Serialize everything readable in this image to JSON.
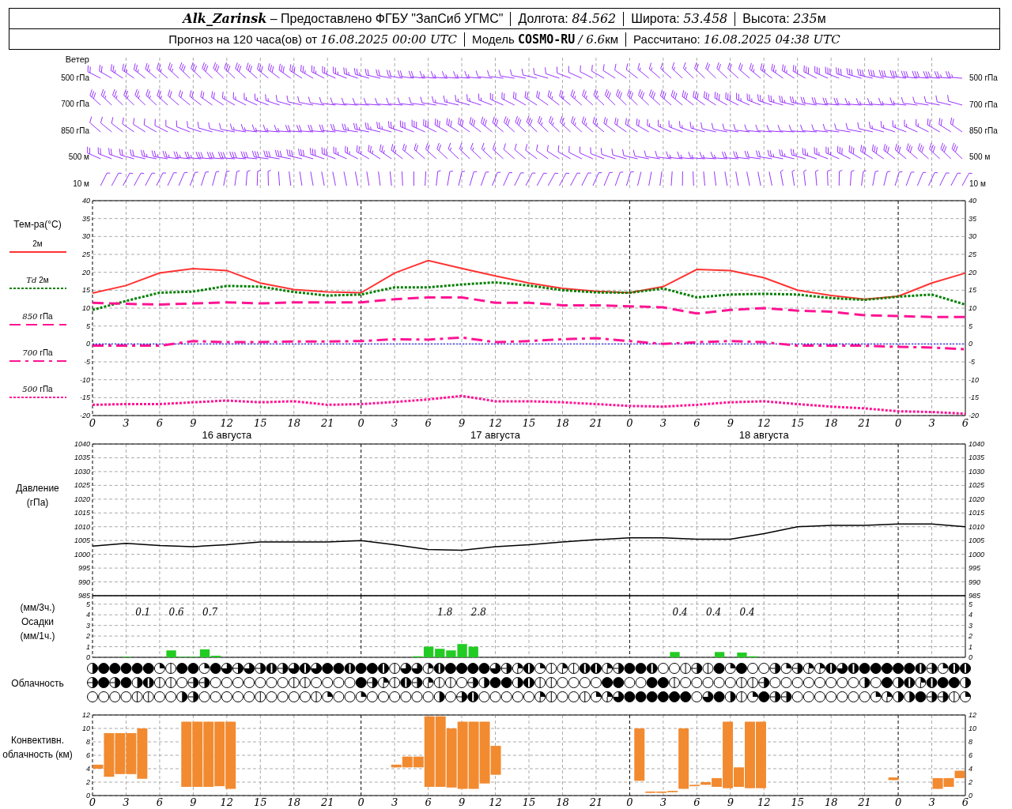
{
  "header": {
    "line1": [
      {
        "station": "Alk_Zarinsk",
        "label": "– Предоставлено ФГБУ \"ЗапСиб УГМС\""
      },
      {
        "label": "Долгота:",
        "value": "84.562"
      },
      {
        "label": "Широта:",
        "value": "53.458"
      },
      {
        "label": "Высота:",
        "value": "235",
        "unit": "м"
      }
    ],
    "line2": [
      {
        "label": "Прогноз на 120 часа(ов) от",
        "value": "16.08.2025 00:00 UTC"
      },
      {
        "label": "Модель",
        "model": "COSMO-RU",
        "value": "/ 6.6",
        "unit": "км"
      },
      {
        "label": "Рассчитано:",
        "value": "16.08.2025 04:38 UTC"
      }
    ]
  },
  "wind": {
    "title": "Ветер",
    "levels_left": [
      "500 гПа",
      "700 гПа",
      "850 гПа",
      "500 м",
      "10 м"
    ],
    "levels_right": [
      "500 гПа",
      "700 гПа",
      "850 гПа",
      "500 м",
      "10 м"
    ]
  },
  "temperature": {
    "dates": [
      "16 августа",
      "17 августа",
      "18 августа"
    ],
    "right_ticks": [
      "40",
      "35",
      "30",
      "25",
      "20",
      "15",
      "10",
      "5",
      "0",
      "-5",
      "-10",
      "-15",
      "-20"
    ],
    "chart_data": {
      "type": "line",
      "ylabel": "Тем-ра(°C)",
      "grid": true,
      "categories": [
        "0",
        "3",
        "6",
        "9",
        "12",
        "15",
        "18",
        "21",
        "0",
        "3",
        "6",
        "9",
        "12",
        "15",
        "18",
        "21",
        "0",
        "3",
        "6",
        "9",
        "12",
        "15",
        "18",
        "21",
        "0",
        "3",
        "6"
      ],
      "ylim": [
        -20,
        40
      ],
      "yticks": [
        -20,
        -15,
        -10,
        -5,
        0,
        5,
        10,
        15,
        20,
        25,
        30,
        35,
        40
      ],
      "series": [
        {
          "name": "2м",
          "color": "#ff3333",
          "line_style": "solid",
          "values": [
            14.2,
            16.3,
            19.8,
            21,
            20.5,
            17,
            15.2,
            14.5,
            14.3,
            19.8,
            23.3,
            21.1,
            19,
            17,
            15.5,
            14.7,
            14.3,
            16,
            20.8,
            20.5,
            18.5,
            15,
            13.5,
            12.5,
            13.3,
            17,
            19.8
          ]
        },
        {
          "name": "*Td* 2м",
          "color": "#008000",
          "line_style": "dotted",
          "values": [
            9.5,
            12,
            14.3,
            14.6,
            16.2,
            16,
            14.5,
            13.5,
            13.8,
            15.8,
            15.8,
            16.6,
            17.2,
            16.3,
            15,
            14.4,
            14.3,
            15.5,
            13,
            13.8,
            14,
            13.8,
            12.8,
            12.3,
            13.2,
            13.8,
            11
          ]
        },
        {
          "name": "*850* гПа",
          "color": "#ff1493",
          "line_style": "dashed",
          "values": [
            11.5,
            11.2,
            11,
            11.3,
            11.6,
            11.3,
            11.6,
            11.6,
            11.6,
            12.5,
            13,
            13,
            11.5,
            11.5,
            10.8,
            10.8,
            10.5,
            10.2,
            8.5,
            9.5,
            10,
            9.3,
            9,
            8,
            7.8,
            7.5,
            7.5
          ]
        },
        {
          "name": "*700* гПа",
          "color": "#ff1493",
          "line_style": "dashdot",
          "values": [
            -0.5,
            -0.5,
            -0.5,
            0.8,
            0.5,
            0.5,
            0.7,
            0.7,
            0.8,
            1.3,
            1.2,
            1.8,
            0.5,
            0.8,
            1.3,
            1.6,
            0.8,
            0,
            0.5,
            0.8,
            0.5,
            -0.5,
            -0.5,
            -0.5,
            -0.8,
            -1,
            -1.5
          ]
        },
        {
          "name": "*500* гПа",
          "color": "#ff1493",
          "line_style": "dotted",
          "values": [
            -17,
            -16.8,
            -16.8,
            -16.3,
            -15.8,
            -16.3,
            -16,
            -17,
            -16.8,
            -16.2,
            -15.5,
            -14.5,
            -16,
            -16,
            -16.3,
            -16.8,
            -17.3,
            -17.5,
            -17,
            -16.3,
            -16,
            -16.8,
            -17.5,
            -18,
            -18.8,
            -19,
            -19.5
          ]
        }
      ],
      "ref_lines": [
        {
          "axis": "y",
          "value": 0,
          "color": "#0000ff"
        }
      ]
    }
  },
  "pressure": {
    "right_ticks": [
      "1040",
      "1035",
      "1030",
      "1025",
      "1020",
      "1015",
      "1010",
      "1005",
      "1000",
      "995",
      "990",
      "985"
    ],
    "chart_data": {
      "type": "line",
      "ylabel": "Давление (гПа)",
      "grid": true,
      "ylim": [
        985,
        1040
      ],
      "yticks": [
        985,
        990,
        995,
        1000,
        1005,
        1010,
        1015,
        1020,
        1025,
        1030,
        1035,
        1040
      ],
      "series": [
        {
          "color": "#000000",
          "values": [
            1003,
            1004,
            1003.2,
            1002.8,
            1003.5,
            1004.5,
            1004.5,
            1004.5,
            1005,
            1003.5,
            1001.8,
            1001.5,
            1002.8,
            1003.5,
            1004.5,
            1005.3,
            1006,
            1006,
            1005.5,
            1005.5,
            1007.5,
            1010,
            1010.5,
            1010.5,
            1011,
            1011,
            1010
          ]
        }
      ]
    }
  },
  "precipitation": {
    "labels": [
      "(мм/3ч.)",
      "Осадки",
      "(мм/1ч.)"
    ],
    "right_ticks": [
      "5",
      "4",
      "3",
      "2",
      "1",
      "0"
    ],
    "totals_3h": {
      "1": "0.1",
      "2": "0.6",
      "3": "0.7",
      "10": "1.8",
      "11": "2.8",
      "17": "0.4",
      "18": "0.4",
      "19": "0.4"
    },
    "chart_data": {
      "type": "bar",
      "grid": true,
      "ylim": [
        0,
        5.8
      ],
      "yticks": [
        0,
        1,
        2,
        3,
        4,
        5
      ],
      "series": [
        {
          "color": "#22cc22",
          "values": [
            0,
            0,
            0,
            0.05,
            0,
            0,
            0,
            0.65,
            0.05,
            0.05,
            0.75,
            0.15,
            0,
            0,
            0,
            0,
            0,
            0,
            0,
            0,
            0,
            0,
            0,
            0,
            0,
            0,
            0,
            0,
            0,
            0.1,
            1.0,
            0.8,
            0.65,
            1.25,
            1.0,
            0,
            0,
            0,
            0,
            0,
            0,
            0,
            0,
            0,
            0,
            0,
            0,
            0,
            0,
            0,
            0,
            0,
            0.5,
            0,
            0,
            0,
            0.5,
            0,
            0.45,
            0.1,
            0,
            0,
            0,
            0,
            0,
            0,
            0,
            0,
            0,
            0,
            0,
            0,
            0,
            0,
            0,
            0,
            0,
            0,
            0
          ]
        }
      ]
    }
  },
  "cloudiness": {
    "label": "Облачность",
    "rows": [
      {
        "symbols": [
          {
            "kind": "octa4"
          },
          {
            "kind": "octa8"
          },
          {
            "kind": "octa8"
          },
          {
            "kind": "octa8"
          },
          {
            "kind": "octa8"
          },
          {
            "kind": "octa8"
          },
          {
            "kind": "octa2"
          },
          {
            "kind": "octa1"
          },
          {
            "kind": "octa8"
          },
          {
            "kind": "octa8"
          },
          {
            "kind": "octa2"
          },
          {
            "kind": "octa8"
          },
          {
            "kind": "octa6"
          },
          {
            "kind": "octa5"
          },
          {
            "kind": "octa6"
          },
          {
            "kind": "octa5"
          },
          {
            "kind": "octa7"
          },
          {
            "kind": "octa5"
          },
          {
            "kind": "octa6"
          },
          {
            "kind": "octa7"
          },
          {
            "kind": "octa6"
          },
          {
            "kind": "octa8"
          },
          {
            "kind": "octa8"
          },
          {
            "kind": "octa7"
          },
          {
            "kind": "octa8"
          },
          {
            "kind": "octa8"
          },
          {
            "kind": "octa7"
          },
          {
            "kind": "octa1"
          },
          {
            "kind": "octa6"
          },
          {
            "kind": "octa6"
          },
          {
            "kind": "octa3"
          },
          {
            "kind": "octa7"
          },
          {
            "kind": "octa8"
          },
          {
            "kind": "octa8"
          },
          {
            "kind": "octa8"
          },
          {
            "kind": "octa8"
          },
          {
            "kind": "octa6"
          },
          {
            "kind": "octa5"
          },
          {
            "kind": "octa3"
          },
          {
            "kind": "octa7"
          },
          {
            "kind": "octa2"
          },
          {
            "kind": "octa1"
          },
          {
            "kind": "octa3"
          },
          {
            "kind": "octa1"
          },
          {
            "kind": "octa7"
          },
          {
            "kind": "octa7"
          },
          {
            "kind": "octa3"
          },
          {
            "kind": "octa5"
          },
          {
            "kind": "octa8"
          },
          {
            "kind": "octa8"
          },
          {
            "kind": "octa7"
          },
          {
            "kind": "octa0"
          },
          {
            "kind": "octa0"
          },
          {
            "kind": "octa1"
          },
          {
            "kind": "octa5"
          },
          {
            "kind": "octa1"
          },
          {
            "kind": "octa8"
          },
          {
            "kind": "octa2"
          },
          {
            "kind": "octa8"
          },
          {
            "kind": "octa0"
          },
          {
            "kind": "octa0"
          },
          {
            "kind": "octa5"
          },
          {
            "kind": "octa2"
          },
          {
            "kind": "octa5"
          },
          {
            "kind": "octa3"
          },
          {
            "kind": "octa3"
          },
          {
            "kind": "octa7"
          },
          {
            "kind": "octa6"
          },
          {
            "kind": "octa7"
          },
          {
            "kind": "octa8"
          },
          {
            "kind": "octa8"
          },
          {
            "kind": "octa8"
          },
          {
            "kind": "octa8"
          },
          {
            "kind": "octa8"
          },
          {
            "kind": "octa7"
          },
          {
            "kind": "octa5"
          },
          {
            "kind": "octa2"
          },
          {
            "kind": "octa7"
          },
          {
            "kind": "octa7"
          }
        ]
      },
      {
        "symbols": [
          {
            "kind": "octa5"
          },
          {
            "kind": "octa8"
          },
          {
            "kind": "octa5"
          },
          {
            "kind": "octa8"
          },
          {
            "kind": "octa4"
          },
          {
            "kind": "octa7"
          },
          {
            "kind": "octa1"
          },
          {
            "kind": "octa1"
          },
          {
            "kind": "octa0"
          },
          {
            "kind": "octa5"
          },
          {
            "kind": "octa5"
          },
          {
            "kind": "octa0"
          },
          {
            "kind": "octa0"
          },
          {
            "kind": "octa0"
          },
          {
            "kind": "octa0"
          },
          {
            "kind": "octa0"
          },
          {
            "kind": "octa0"
          },
          {
            "kind": "octa0"
          },
          {
            "kind": "octa1"
          },
          {
            "kind": "octa1"
          },
          {
            "kind": "octa0"
          },
          {
            "kind": "octa0"
          },
          {
            "kind": "octa0"
          },
          {
            "kind": "octa0"
          },
          {
            "kind": "octa8"
          },
          {
            "kind": "octa5"
          },
          {
            "kind": "octa3"
          },
          {
            "kind": "octa1"
          },
          {
            "kind": "octa7"
          },
          {
            "kind": "octa5"
          },
          {
            "kind": "octa3"
          },
          {
            "kind": "octa1"
          },
          {
            "kind": "octa1"
          },
          {
            "kind": "octa0"
          },
          {
            "kind": "octa5"
          },
          {
            "kind": "octa4"
          },
          {
            "kind": "octa8"
          },
          {
            "kind": "octa8"
          },
          {
            "kind": "octa4"
          },
          {
            "kind": "octa7"
          },
          {
            "kind": "octa1"
          },
          {
            "kind": "octa1"
          },
          {
            "kind": "octa0"
          },
          {
            "kind": "octa0"
          },
          {
            "kind": "octa0"
          },
          {
            "kind": "octa0"
          },
          {
            "kind": "octa8"
          },
          {
            "kind": "octa8"
          },
          {
            "kind": "octa0"
          },
          {
            "kind": "octa0"
          },
          {
            "kind": "octa8"
          },
          {
            "kind": "octa8"
          },
          {
            "kind": "octa1"
          },
          {
            "kind": "octa0"
          },
          {
            "kind": "octa0"
          },
          {
            "kind": "octa0"
          },
          {
            "kind": "octa0"
          },
          {
            "kind": "octa0"
          },
          {
            "kind": "octa1"
          },
          {
            "kind": "octa1"
          },
          {
            "kind": "octa5"
          },
          {
            "kind": "octa0"
          },
          {
            "kind": "octa0"
          },
          {
            "kind": "octa0"
          },
          {
            "kind": "octa0"
          },
          {
            "kind": "octa0"
          },
          {
            "kind": "octa0"
          },
          {
            "kind": "octa0"
          },
          {
            "kind": "octa0"
          },
          {
            "kind": "octa4"
          },
          {
            "kind": "octa0"
          },
          {
            "kind": "octa8"
          },
          {
            "kind": "octa4"
          },
          {
            "kind": "octa7"
          },
          {
            "kind": "octa3"
          },
          {
            "kind": "octa7"
          },
          {
            "kind": "octa8"
          },
          {
            "kind": "octa8"
          },
          {
            "kind": "octa4"
          }
        ]
      },
      {
        "symbols": [
          {
            "kind": "octa0"
          },
          {
            "kind": "octa0"
          },
          {
            "kind": "octa0"
          },
          {
            "kind": "octa0"
          },
          {
            "kind": "octa1"
          },
          {
            "kind": "octa1"
          },
          {
            "kind": "octa0"
          },
          {
            "kind": "octa0"
          },
          {
            "kind": "octa4"
          },
          {
            "kind": "octa5"
          },
          {
            "kind": "octa0"
          },
          {
            "kind": "octa0"
          },
          {
            "kind": "octa0"
          },
          {
            "kind": "octa0"
          },
          {
            "kind": "octa0"
          },
          {
            "kind": "octa1"
          },
          {
            "kind": "octa0"
          },
          {
            "kind": "octa0"
          },
          {
            "kind": "octa0"
          },
          {
            "kind": "octa0"
          },
          {
            "kind": "octa1"
          },
          {
            "kind": "octa2"
          },
          {
            "kind": "octa0"
          },
          {
            "kind": "octa0"
          },
          {
            "kind": "octa2"
          },
          {
            "kind": "octa0"
          },
          {
            "kind": "octa0"
          },
          {
            "kind": "octa0"
          },
          {
            "kind": "octa0"
          },
          {
            "kind": "octa0"
          },
          {
            "kind": "octa0"
          },
          {
            "kind": "octa4"
          },
          {
            "kind": "octa0"
          },
          {
            "kind": "octa5"
          },
          {
            "kind": "octa7"
          },
          {
            "kind": "octa0"
          },
          {
            "kind": "octa0"
          },
          {
            "kind": "octa0"
          },
          {
            "kind": "octa0"
          },
          {
            "kind": "octa0"
          },
          {
            "kind": "octa3"
          },
          {
            "kind": "octa1"
          },
          {
            "kind": "octa0"
          },
          {
            "kind": "octa0"
          },
          {
            "kind": "octa1"
          },
          {
            "kind": "octa2"
          },
          {
            "kind": "octa3"
          },
          {
            "kind": "octa6"
          },
          {
            "kind": "octa8"
          },
          {
            "kind": "octa8"
          },
          {
            "kind": "octa8"
          },
          {
            "kind": "octa8"
          },
          {
            "kind": "octa8"
          },
          {
            "kind": "octa8"
          },
          {
            "kind": "octa0"
          },
          {
            "kind": "octa6"
          },
          {
            "kind": "octa8"
          },
          {
            "kind": "octa4"
          },
          {
            "kind": "octa1"
          },
          {
            "kind": "octa2"
          },
          {
            "kind": "octa8"
          },
          {
            "kind": "octa5"
          },
          {
            "kind": "octa5"
          },
          {
            "kind": "octa0"
          },
          {
            "kind": "octa0"
          },
          {
            "kind": "octa0"
          },
          {
            "kind": "octa0"
          },
          {
            "kind": "octa0"
          },
          {
            "kind": "octa0"
          },
          {
            "kind": "octa0"
          },
          {
            "kind": "octa2"
          },
          {
            "kind": "octa3"
          },
          {
            "kind": "octa4"
          },
          {
            "kind": "octa4"
          },
          {
            "kind": "octa8"
          },
          {
            "kind": "octa5"
          },
          {
            "kind": "octa5"
          },
          {
            "kind": "octa1"
          },
          {
            "kind": "octa2"
          }
        ]
      }
    ]
  },
  "convective": {
    "right_ticks": [
      "12",
      "10",
      "8",
      "6",
      "4",
      "2",
      "0"
    ],
    "hour_labels": [
      "0",
      "3",
      "6",
      "9",
      "12",
      "15",
      "18",
      "21",
      "0",
      "3",
      "6",
      "9",
      "12",
      "15",
      "18",
      "21",
      "0",
      "3",
      "6",
      "9",
      "12",
      "15",
      "18",
      "21",
      "0",
      "3",
      "6"
    ],
    "chart_data": {
      "type": "candlestick",
      "ylabel": "Конвективн. облачность (км)",
      "grid": true,
      "ylim": [
        0,
        12
      ],
      "yticks": [
        0,
        2,
        4,
        6,
        8,
        10,
        12
      ],
      "ohlc": [
        [
          4,
          4.6,
          4,
          4.6
        ],
        [
          2.8,
          9.3,
          2.8,
          9.3
        ],
        [
          3.2,
          9.3,
          3.2,
          9.3
        ],
        [
          3.2,
          9.3,
          3.2,
          9.3
        ],
        [
          2.5,
          10,
          2.5,
          10
        ],
        null,
        null,
        null,
        [
          1.3,
          11,
          1.3,
          11
        ],
        [
          1.3,
          11,
          1.3,
          11
        ],
        [
          1.3,
          11,
          1.3,
          11
        ],
        [
          1.4,
          11,
          1.4,
          11
        ],
        [
          1,
          11,
          1,
          11
        ],
        null,
        null,
        null,
        null,
        null,
        null,
        null,
        null,
        null,
        null,
        null,
        null,
        null,
        null,
        [
          4.2,
          4.6,
          4.2,
          4.6
        ],
        [
          4.2,
          5.8,
          4.2,
          5.8
        ],
        [
          4.2,
          5.8,
          4.2,
          5.8
        ],
        [
          1.3,
          11.8,
          1.3,
          11.8
        ],
        [
          1.3,
          11.8,
          1.3,
          11.8
        ],
        [
          1.2,
          10,
          1.2,
          10
        ],
        [
          1,
          11,
          1,
          11
        ],
        [
          1,
          11,
          1,
          11
        ],
        [
          1.8,
          11,
          1.8,
          11
        ],
        [
          3.1,
          7.4,
          3.1,
          7.4
        ],
        null,
        null,
        null,
        null,
        null,
        null,
        null,
        null,
        null,
        null,
        null,
        null,
        [
          2.2,
          10,
          2.2,
          10
        ],
        [
          0.4,
          0.6,
          0.4,
          0.6
        ],
        [
          0.4,
          0.6,
          0.4,
          0.6
        ],
        [
          0.5,
          0.7,
          0.5,
          0.7
        ],
        [
          1,
          10,
          1,
          10
        ],
        [
          1.4,
          1.6,
          1.4,
          1.6
        ],
        [
          1.6,
          2,
          1.6,
          2
        ],
        [
          1.3,
          2.6,
          1.3,
          2.6
        ],
        [
          1.1,
          11,
          1.1,
          11
        ],
        [
          1.3,
          4.2,
          1.3,
          4.2
        ],
        [
          1.1,
          11,
          1.1,
          11
        ],
        [
          1.1,
          11,
          1.1,
          11
        ],
        null,
        null,
        null,
        null,
        null,
        null,
        null,
        null,
        null,
        null,
        null,
        [
          2.3,
          2.7,
          2.3,
          2.7
        ],
        null,
        null,
        null,
        [
          1,
          2.6,
          1,
          2.6
        ],
        [
          1.3,
          2.6,
          1.3,
          2.6
        ],
        [
          2.6,
          3.7,
          2.6,
          3.7
        ]
      ]
    }
  }
}
